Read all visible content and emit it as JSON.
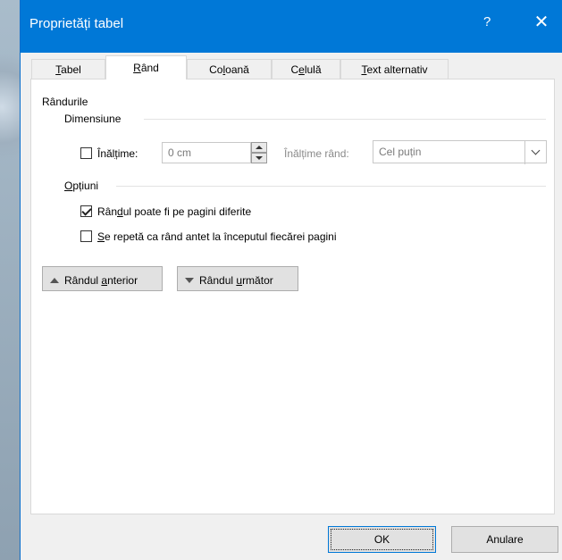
{
  "dialog": {
    "title": "Proprietăți tabel",
    "help": "?",
    "close": "✕"
  },
  "tabs": [
    {
      "pre": "",
      "ul": "T",
      "post": "abel"
    },
    {
      "pre": "",
      "ul": "R",
      "post": "ând"
    },
    {
      "pre": "Co",
      "ul": "l",
      "post": "oană"
    },
    {
      "pre": "C",
      "ul": "e",
      "post": "lulă"
    },
    {
      "pre": "",
      "ul": "T",
      "post": "ext alternativ"
    }
  ],
  "active_tab": "Rând",
  "rows_section": {
    "title": "Rândurile",
    "dimension": {
      "title": "Dimensiune",
      "height_checkbox": {
        "pre": "Înăl",
        "ul": "ț",
        "post": "ime:",
        "checked": false
      },
      "height_value": "0 cm",
      "row_height_label": "Înălțime rând:",
      "row_height_value": "Cel puțin"
    },
    "options": {
      "pre": "",
      "ul": "O",
      "post": "pțiuni",
      "allow_break": {
        "pre": "Rân",
        "ul": "d",
        "post": "ul poate fi pe pagini diferite",
        "checked": true
      },
      "repeat_header": {
        "pre": "",
        "ul": "S",
        "post": "e repetă ca rând antet la începutul fiecărei pagini",
        "checked": false
      }
    }
  },
  "nav": {
    "prev": {
      "pre": "Rândul ",
      "ul": "a",
      "post": "nterior"
    },
    "next": {
      "pre": "Rândul ",
      "ul": "u",
      "post": "rmător"
    }
  },
  "footer": {
    "ok": "OK",
    "cancel": "Anulare"
  },
  "colors": {
    "titlebar": "#0078d7",
    "dialog_bg": "#f0f0f0"
  }
}
